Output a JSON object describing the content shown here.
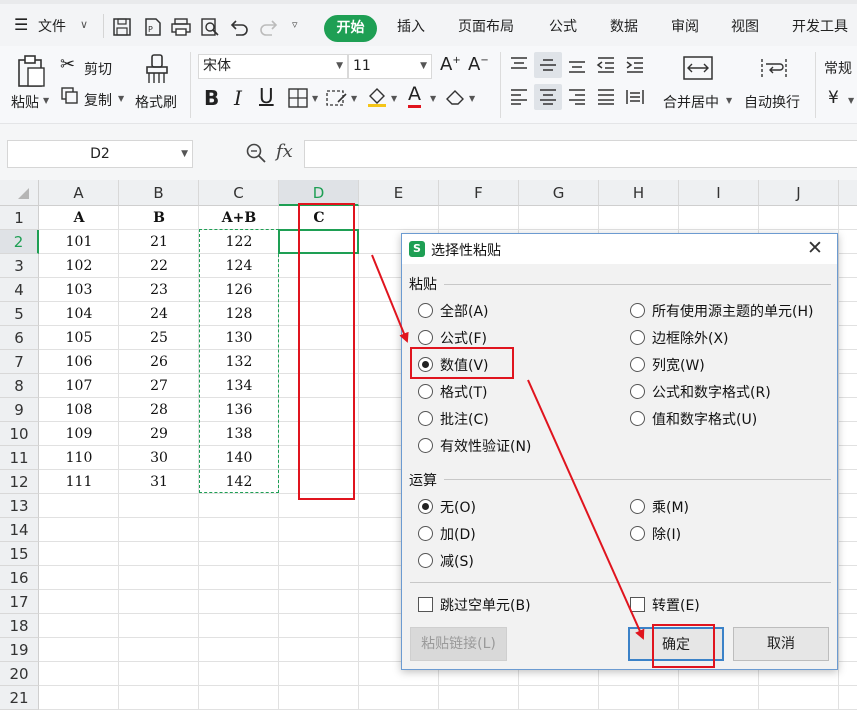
{
  "menubar": {
    "file_label": "文件",
    "tabs": [
      "开始",
      "插入",
      "页面布局",
      "公式",
      "数据",
      "审阅",
      "视图",
      "开发工具"
    ],
    "active_tab": "开始"
  },
  "ribbon": {
    "paste": "粘贴",
    "cut": "剪切",
    "copy": "复制",
    "format_painter": "格式刷",
    "font_name": "宋体",
    "font_size": "11",
    "merge_center": "合并居中",
    "wrap_text": "自动换行",
    "number_format": "常规",
    "currency_symbol": "¥"
  },
  "formula_bar": {
    "name_box": "D2",
    "fx": "fx",
    "formula": ""
  },
  "sheet": {
    "columns": [
      "A",
      "B",
      "C",
      "D",
      "E",
      "F",
      "G",
      "H",
      "I",
      "J"
    ],
    "rows": [
      "1",
      "2",
      "3",
      "4",
      "5",
      "6",
      "7",
      "8",
      "9",
      "10",
      "11",
      "12",
      "13",
      "14",
      "15",
      "16",
      "17",
      "18",
      "19",
      "20",
      "21"
    ],
    "header_row": [
      "A",
      "B",
      "A+B",
      "C"
    ],
    "data": [
      [
        "101",
        "21",
        "122"
      ],
      [
        "102",
        "22",
        "124"
      ],
      [
        "103",
        "23",
        "126"
      ],
      [
        "104",
        "24",
        "128"
      ],
      [
        "105",
        "25",
        "130"
      ],
      [
        "106",
        "26",
        "132"
      ],
      [
        "107",
        "27",
        "134"
      ],
      [
        "108",
        "28",
        "136"
      ],
      [
        "109",
        "29",
        "138"
      ],
      [
        "110",
        "30",
        "140"
      ],
      [
        "111",
        "31",
        "142"
      ]
    ],
    "active_cell": "D2",
    "accent_color": "#1e9f54"
  },
  "dialog": {
    "title": "选择性粘贴",
    "paste_group": "粘贴",
    "paste_left": [
      "全部(A)",
      "公式(F)",
      "数值(V)",
      "格式(T)",
      "批注(C)",
      "有效性验证(N)"
    ],
    "paste_right": [
      "所有使用源主题的单元(H)",
      "边框除外(X)",
      "列宽(W)",
      "公式和数字格式(R)",
      "值和数字格式(U)"
    ],
    "paste_selected": "数值(V)",
    "op_group": "运算",
    "op_left": [
      "无(O)",
      "加(D)",
      "减(S)"
    ],
    "op_right": [
      "乘(M)",
      "除(I)"
    ],
    "op_selected": "无(O)",
    "skip_blanks": "跳过空单元(B)",
    "transpose": "转置(E)",
    "paste_link": "粘贴链接(L)",
    "ok": "确定",
    "cancel": "取消"
  },
  "annotation_color": "#e0141e"
}
